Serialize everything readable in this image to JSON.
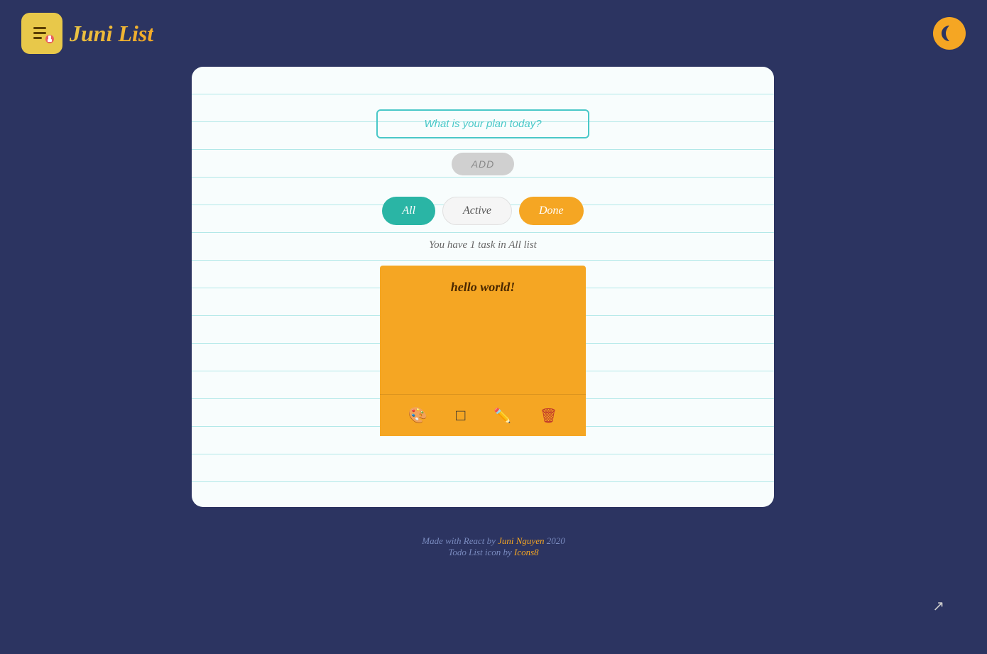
{
  "header": {
    "logo_text": "Juni List",
    "theme_toggle_label": "Toggle theme"
  },
  "main": {
    "input_placeholder": "What is your plan today?",
    "add_button_label": "ADD",
    "filters": [
      {
        "id": "all",
        "label": "All",
        "state": "active"
      },
      {
        "id": "active",
        "label": "Active",
        "state": "inactive"
      },
      {
        "id": "done",
        "label": "Done",
        "state": "done"
      }
    ],
    "status_text": "You have 1 task in All list",
    "task": {
      "title": "hello world!",
      "color": "#f5a623"
    }
  },
  "footer": {
    "line1_prefix": "Made with React by ",
    "author": "Juni Nguyen",
    "line1_suffix": " 2020",
    "line2_prefix": "Todo List icon by ",
    "icon_source": "Icons8"
  },
  "icons": {
    "palette": "🎨",
    "checkbox": "☐",
    "pencil": "✏",
    "trash": "🗑"
  }
}
